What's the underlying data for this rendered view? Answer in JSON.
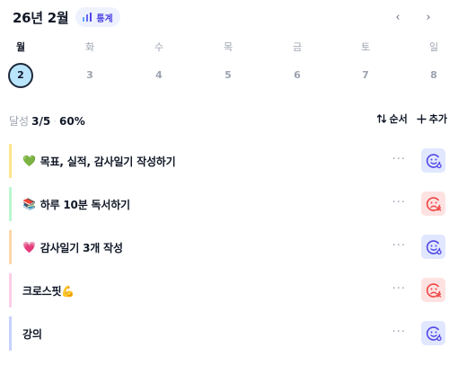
{
  "header": {
    "month_title": "26년 2월",
    "stats_label": "통계",
    "prev_label": "‹",
    "next_label": "›"
  },
  "week": {
    "days": [
      {
        "label": "월",
        "date": "2",
        "today": true
      },
      {
        "label": "화",
        "date": "3",
        "today": false
      },
      {
        "label": "수",
        "date": "4",
        "today": false
      },
      {
        "label": "목",
        "date": "5",
        "today": false
      },
      {
        "label": "금",
        "date": "6",
        "today": false
      },
      {
        "label": "토",
        "date": "7",
        "today": false
      },
      {
        "label": "일",
        "date": "8",
        "today": false
      }
    ]
  },
  "summary": {
    "prefix": "달성",
    "count": "3/5",
    "separator": "·",
    "percent": "60%"
  },
  "actions": {
    "sort_label": "순서",
    "add_label": "추가"
  },
  "tasks": [
    {
      "emoji": "💚",
      "text": "목표, 실적, 감사일기 작성하기",
      "accent": "#fde68a",
      "status": "good",
      "more": "···"
    },
    {
      "emoji": "📚",
      "text": "하루 10분 독서하기",
      "accent": "#bbf7d0",
      "status": "bad",
      "more": "···"
    },
    {
      "emoji": "💗",
      "text": "감사일기 3개 작성",
      "accent": "#fed7aa",
      "status": "good",
      "more": "···"
    },
    {
      "emoji": "",
      "text": "크로스핏💪",
      "accent": "#fbcfe8",
      "status": "bad",
      "more": "···"
    },
    {
      "emoji": "",
      "text": "강의",
      "accent": "#c7d2fe",
      "status": "good",
      "more": "···"
    }
  ],
  "colors": {
    "good_face": "#4f46e5",
    "bad_face": "#ef4444",
    "accent": "#4f46e5"
  }
}
